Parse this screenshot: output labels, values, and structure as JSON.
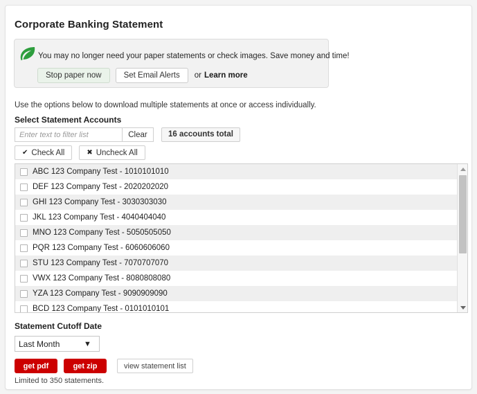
{
  "page": {
    "title": "Corporate Banking Statement"
  },
  "banner": {
    "icon": "leaf-icon",
    "message": "You may no longer need your paper statements or check images. Save money and time!",
    "stop_paper_label": "Stop paper now",
    "set_email_alerts_label": "Set Email Alerts",
    "or_text": "or",
    "learn_more_label": "Learn more",
    "accent_green": "#2e9e3e",
    "stop_button_bg": "#eaf3ea"
  },
  "instructions": "Use the options below to download multiple statements at once or access individually.",
  "accounts_section": {
    "label": "Select Statement Accounts",
    "filter": {
      "placeholder": "Enter text to filter list",
      "value": "",
      "clear_label": "Clear"
    },
    "total_badge": "16 accounts total",
    "check_all_label": "Check All",
    "check_all_icon": "check-icon",
    "uncheck_all_label": "Uncheck All",
    "uncheck_all_icon": "cross-icon",
    "rows": [
      {
        "label": "ABC 123 Company Test - 1010101010",
        "checked": false
      },
      {
        "label": "DEF 123 Company Test - 2020202020",
        "checked": false
      },
      {
        "label": "GHI 123 Company Test - 3030303030",
        "checked": false
      },
      {
        "label": "JKL 123 Company Test - 4040404040",
        "checked": false
      },
      {
        "label": "MNO 123 Company Test - 5050505050",
        "checked": false
      },
      {
        "label": "PQR 123 Company Test - 6060606060",
        "checked": false
      },
      {
        "label": "STU 123 Company Test - 7070707070",
        "checked": false
      },
      {
        "label": "VWX 123 Company Test - 8080808080",
        "checked": false
      },
      {
        "label": "YZA 123 Company Test - 9090909090",
        "checked": false
      },
      {
        "label": "BCD 123 Company Test - 0101010101",
        "checked": false
      }
    ],
    "scrollbar": {
      "up_icon": "chevron-up-icon",
      "down_icon": "chevron-down-icon"
    }
  },
  "cutoff": {
    "label": "Statement Cutoff Date",
    "selected": "Last Month",
    "chevron_icon": "chevron-down-icon"
  },
  "actions": {
    "get_pdf_label": "get pdf",
    "get_zip_label": "get zip",
    "view_list_label": "view statement list",
    "red": "#cc0000"
  },
  "limit_note": "Limited to 350 statements."
}
